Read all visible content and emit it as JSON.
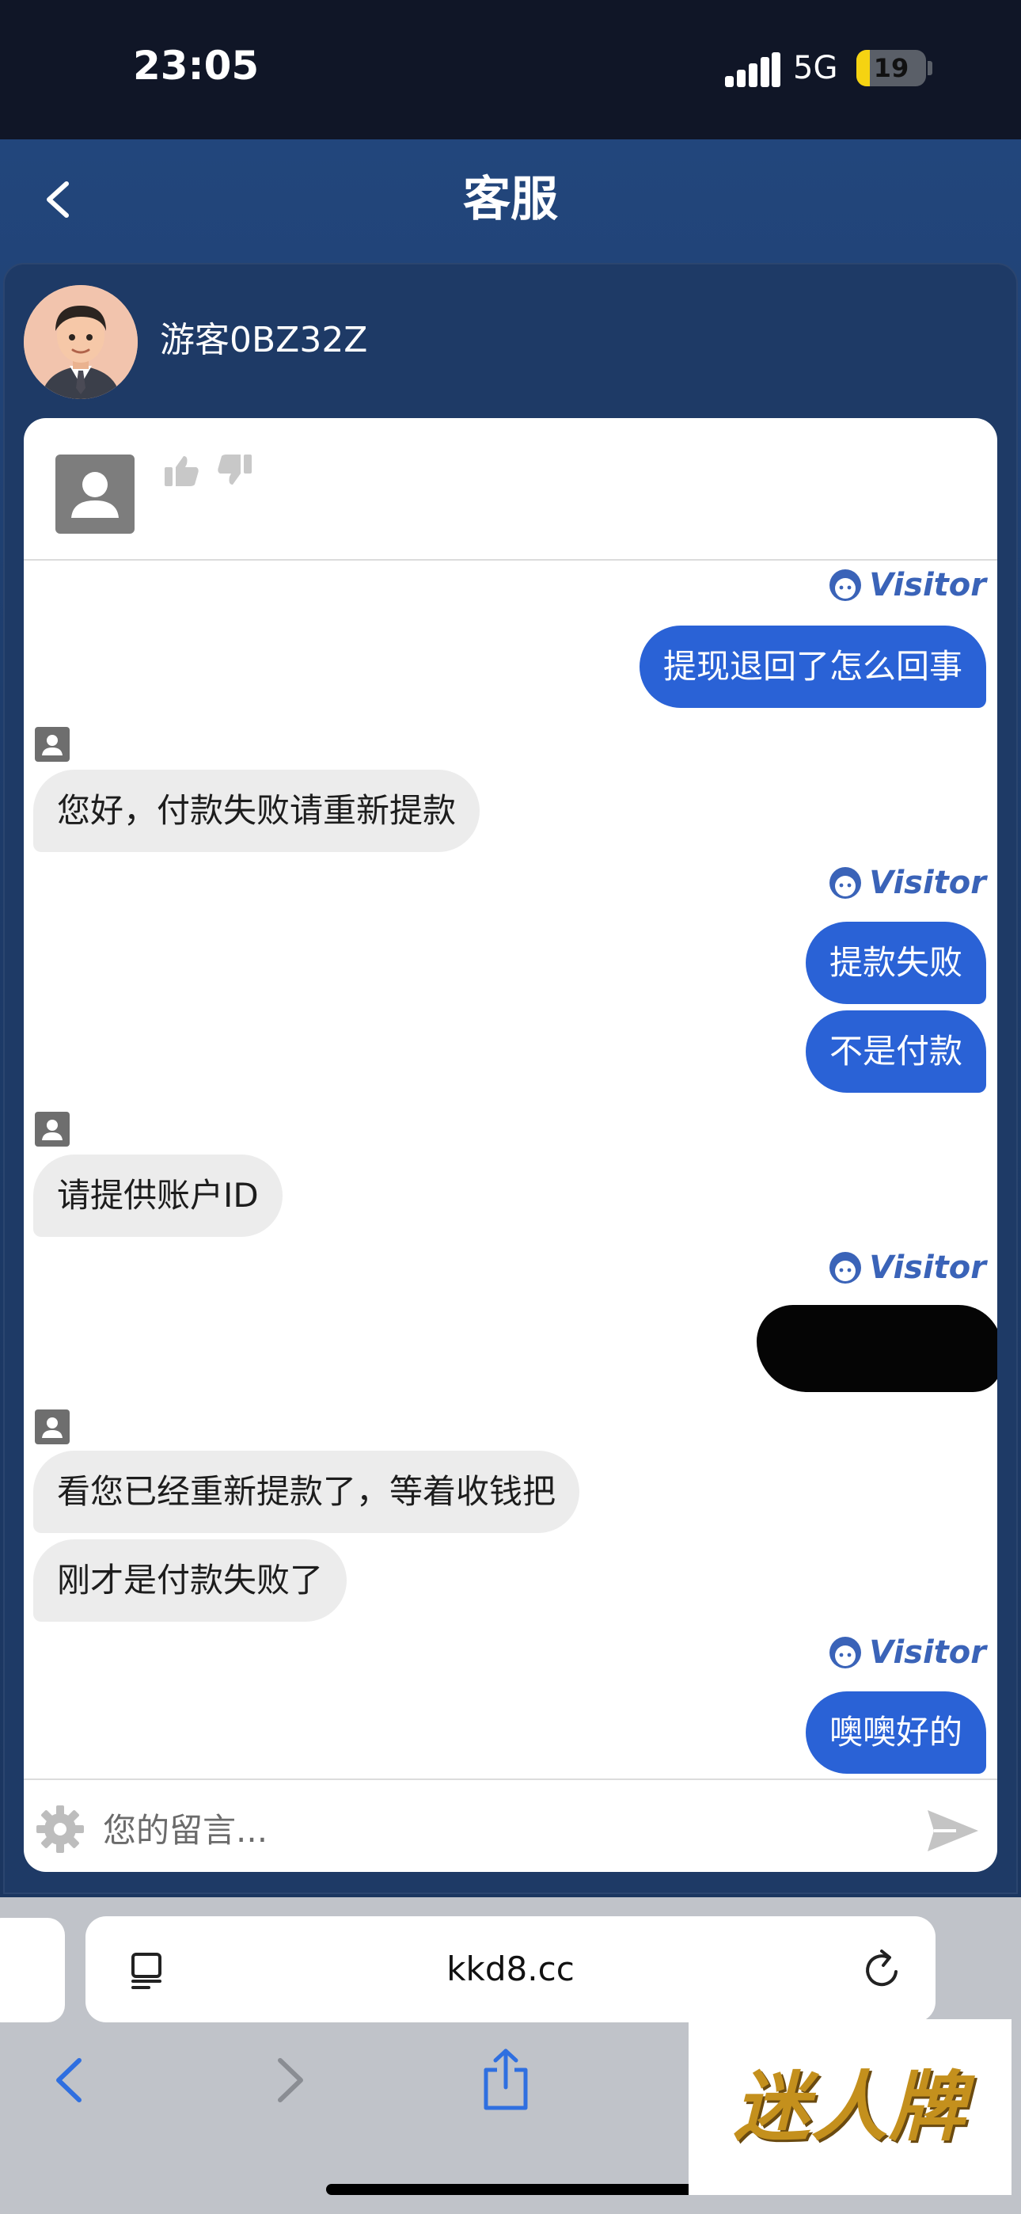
{
  "status_bar": {
    "time": "23:05",
    "network": "5G",
    "battery_percent": 19,
    "battery_label": "19"
  },
  "header": {
    "title": "客服"
  },
  "user": {
    "name": "游客0BZ32Z"
  },
  "chat": {
    "visitor_label": "Visitor",
    "messages": [
      {
        "from": "visitor",
        "text": "提现退回了怎么回事"
      },
      {
        "from": "agent",
        "text": "您好，付款失败请重新提款"
      },
      {
        "from": "visitor",
        "text": "提款失败"
      },
      {
        "from": "visitor",
        "text": "不是付款"
      },
      {
        "from": "agent",
        "text": "请提供账户ID"
      },
      {
        "from": "agent",
        "text": "看您已经重新提款了，等着收钱把"
      },
      {
        "from": "agent",
        "text": "刚才是付款失败了"
      },
      {
        "from": "visitor",
        "text": "噢噢好的"
      }
    ]
  },
  "input": {
    "placeholder": "您的留言..."
  },
  "browser": {
    "url": "kkd8.cc"
  },
  "watermark": {
    "text": "迷人牌"
  },
  "colors": {
    "header_bg": "#22467c",
    "visitor_bubble": "#2a62d6",
    "agent_bubble": "#ececec",
    "visitor_tag": "#3a63b8"
  }
}
